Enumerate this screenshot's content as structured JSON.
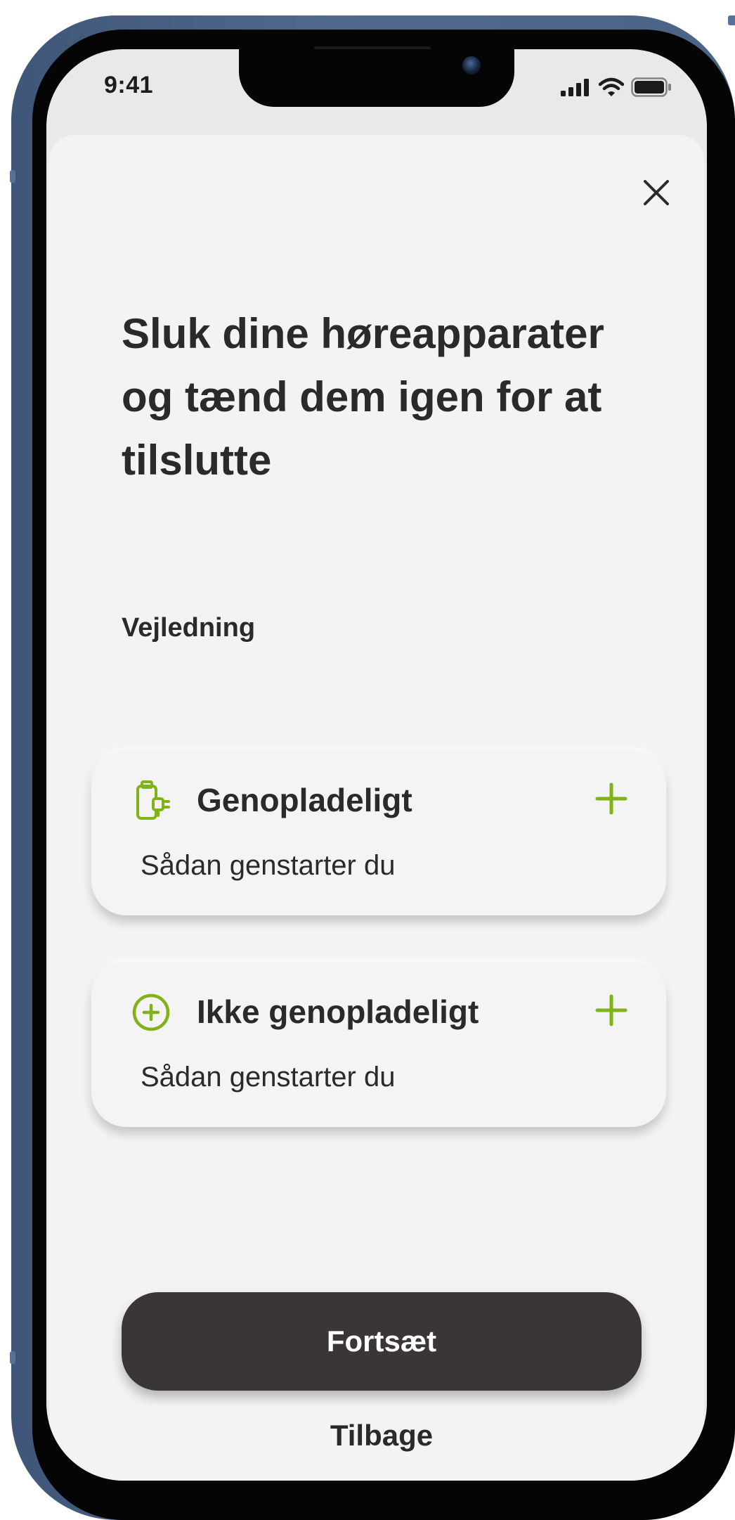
{
  "status_bar": {
    "time": "9:41"
  },
  "modal": {
    "title": "Sluk dine høreapparater og tænd dem igen for at tilslutte",
    "section_label": "Vejledning",
    "cards": [
      {
        "title": "Genopladeligt",
        "subtitle": "Sådan genstarter du",
        "icon": "rechargeable-battery-icon"
      },
      {
        "title": "Ikke genopladeligt",
        "subtitle": "Sådan genstarter du",
        "icon": "plus-circle-icon"
      }
    ],
    "continue_label": "Fortsæt",
    "back_label": "Tilbage"
  },
  "colors": {
    "accent": "#7fb317",
    "button_dark": "#3a3638",
    "text": "#2a2a2a",
    "sheet_bg": "#f3f3f3",
    "frame": "#4b6387"
  }
}
